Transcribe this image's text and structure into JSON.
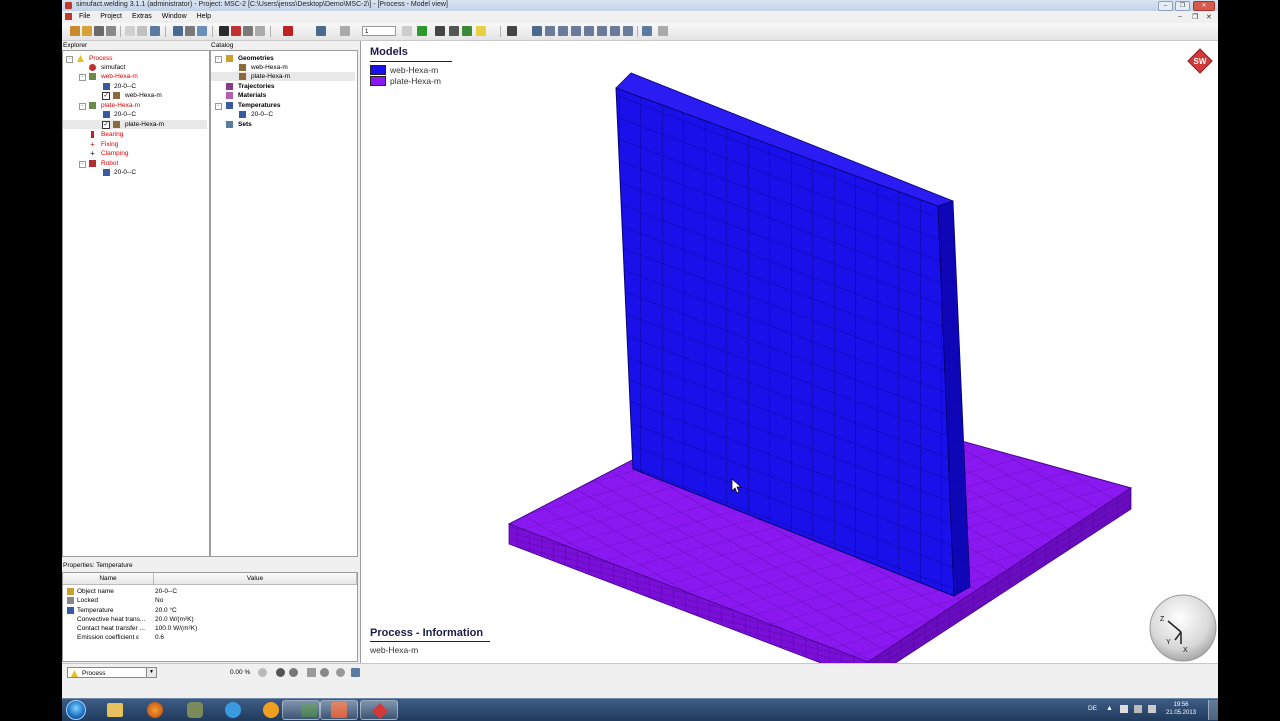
{
  "window": {
    "title": "simufact.welding 3.1.1 (administrator) - Project: MSC-2 [C:\\Users\\jenss\\Desktop\\Demo\\MSC-2\\] - [Process - Model view]",
    "controls": [
      "minimize-icon",
      "restore-icon",
      "close-icon"
    ]
  },
  "menu": {
    "items": [
      "File",
      "Project",
      "Extras",
      "Window",
      "Help"
    ],
    "inner_controls": [
      "minimize-icon",
      "restore-icon",
      "close-icon"
    ]
  },
  "toolbar": {
    "frame_value": "1"
  },
  "explorer": {
    "header": "Explorer",
    "items": [
      {
        "label": "Process",
        "color": "#e00000",
        "icon": "process-warning-icon"
      },
      {
        "label": "simufact",
        "color": "#000000",
        "icon": "simufact-icon"
      },
      {
        "label": "web-Hexa-m",
        "color": "#e00000",
        "icon": "part-icon"
      },
      {
        "label": "20-0--C",
        "color": "#000000",
        "icon": "temperature-icon"
      },
      {
        "label": "web-Hexa-m",
        "color": "#000000",
        "icon": "geometry-icon",
        "checked": true
      },
      {
        "label": "plate-Hexa-m",
        "color": "#e00000",
        "icon": "part-icon"
      },
      {
        "label": "20-0--C",
        "color": "#000000",
        "icon": "temperature-icon"
      },
      {
        "label": "plate-Hexa-m",
        "color": "#000000",
        "icon": "geometry-icon",
        "checked": true
      },
      {
        "label": "Bearing",
        "color": "#e00000",
        "icon": "bearing-icon"
      },
      {
        "label": "Fixing",
        "color": "#e00000",
        "icon": "fixing-icon"
      },
      {
        "label": "Clamping",
        "color": "#e00000",
        "icon": "clamping-icon"
      },
      {
        "label": "Robot",
        "color": "#e00000",
        "icon": "robot-icon"
      },
      {
        "label": "20-0--C",
        "color": "#000000",
        "icon": "temperature-icon"
      }
    ]
  },
  "catalog": {
    "header": "Catalog",
    "items": [
      {
        "label": "Geometries",
        "bold": true,
        "icon": "geometries-icon"
      },
      {
        "label": "web-Hexa-m",
        "bold": false,
        "icon": "geometry-icon"
      },
      {
        "label": "plate-Hexa-m",
        "bold": false,
        "icon": "geometry-icon"
      },
      {
        "label": "Trajectories",
        "bold": true,
        "icon": "trajectories-icon"
      },
      {
        "label": "Materials",
        "bold": true,
        "icon": "materials-icon"
      },
      {
        "label": "Temperatures",
        "bold": true,
        "icon": "temperatures-icon"
      },
      {
        "label": "20-0--C",
        "bold": false,
        "icon": "temperature-icon"
      },
      {
        "label": "Sets",
        "bold": true,
        "icon": "sets-icon"
      }
    ]
  },
  "properties": {
    "header": "Properties: Temperature",
    "columns": [
      "Name",
      "Value"
    ],
    "rows": [
      {
        "name": "Object name",
        "value": "20-0--C",
        "icon": "pencil-icon"
      },
      {
        "name": "Locked",
        "value": "No",
        "icon": "lock-icon"
      },
      {
        "name": "Temperature",
        "value": "20.0 °C",
        "icon": "temperature-icon"
      },
      {
        "name": "Convective heat trans...",
        "value": "20.0 W/(m²K)",
        "icon": ""
      },
      {
        "name": "Contact heat transfer ...",
        "value": "100.0 W/(m²K)",
        "icon": ""
      },
      {
        "name": "Emission coefficient ε",
        "value": "0.6",
        "icon": ""
      }
    ]
  },
  "status_strip": {
    "process_select": "Process",
    "progress": "0.00 %"
  },
  "viewport": {
    "models_title": "Models",
    "legend": [
      {
        "label": "web-Hexa-m",
        "color": "#1a10ea"
      },
      {
        "label": "plate-Hexa-m",
        "color": "#8a18f0"
      }
    ],
    "info_title": "Process - Information",
    "info_value": "web-Hexa-m",
    "logo_text": "SW",
    "axes": {
      "z": "Z",
      "y": "Y",
      "x": "X"
    }
  },
  "taskbar": {
    "apps": [
      "windows-explorer-icon",
      "firefox-icon",
      "gimp-icon",
      "internet-explorer-icon",
      "media-player-icon",
      "terminal-icon",
      "powerpoint-icon",
      "simufact-icon"
    ],
    "language": "DE",
    "time": "19:56",
    "date": "21.05.2013"
  }
}
